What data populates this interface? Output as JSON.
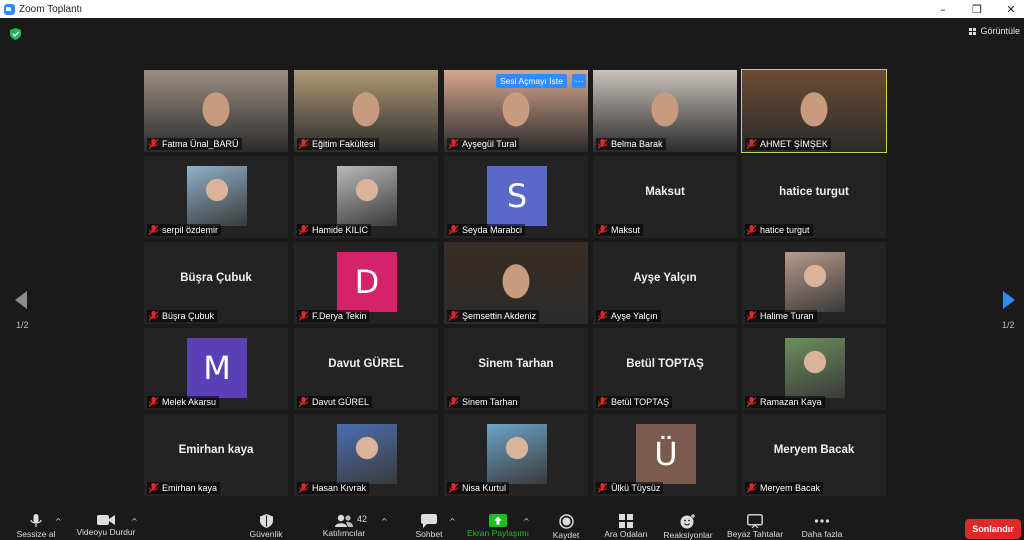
{
  "window": {
    "title": "Zoom Toplantı",
    "minimize": "–",
    "restore": "❐",
    "close": "✕"
  },
  "view_button": "Görüntüle",
  "page_indicator_left": "1/2",
  "page_indicator_right": "1/2",
  "unmute_request": "Sesi Açmayı İste",
  "more_dots": "···",
  "participants": [
    {
      "name": "Fatma Ünal_BARÜ",
      "display": "",
      "type": "video",
      "bg": "#9b8f84"
    },
    {
      "name": "Eğitim Fakültesi",
      "display": "",
      "type": "video",
      "bg": "#b09a76"
    },
    {
      "name": "Ayşegül Tural",
      "display": "",
      "type": "video",
      "bg": "#d7a690"
    },
    {
      "name": "Belma Barak",
      "display": "",
      "type": "video",
      "bg": "#c9c3bd"
    },
    {
      "name": "AHMET ŞİMŞEK",
      "display": "",
      "type": "video",
      "bg": "#6c4b33"
    },
    {
      "name": "serpil özdemir",
      "display": "",
      "type": "photo",
      "bg": "#8fb1c9"
    },
    {
      "name": "Hamide KILIC",
      "display": "",
      "type": "photo",
      "bg": "#b9b9b9"
    },
    {
      "name": "Seyda Marabci",
      "display": "S",
      "type": "letter",
      "bg": "#5a69c8"
    },
    {
      "name": "Maksut",
      "display": "Maksut",
      "type": "name"
    },
    {
      "name": "hatice turgut",
      "display": "hatice turgut",
      "type": "name"
    },
    {
      "name": "Büşra Çubuk",
      "display": "Büşra Çubuk",
      "type": "name"
    },
    {
      "name": "F.Derya Tekin",
      "display": "D",
      "type": "letter",
      "bg": "#d3246b"
    },
    {
      "name": "Şemsettin Akdeniz",
      "display": "",
      "type": "video",
      "bg": "#3a2d25"
    },
    {
      "name": "Ayşe Yalçın",
      "display": "Ayşe Yalçın",
      "type": "name"
    },
    {
      "name": "Halime Turan",
      "display": "",
      "type": "photo",
      "bg": "#b89a88"
    },
    {
      "name": "Melek Akarsu",
      "display": "M",
      "type": "letter",
      "bg": "#5b3fb6"
    },
    {
      "name": "Davut GÜREL",
      "display": "Davut GÜREL",
      "type": "name"
    },
    {
      "name": "Sinem Tarhan",
      "display": "Sinem Tarhan",
      "type": "name"
    },
    {
      "name": "Betül TOPTAŞ",
      "display": "Betül TOPTAŞ",
      "type": "name"
    },
    {
      "name": "Ramazan Kaya",
      "display": "",
      "type": "photo",
      "bg": "#6d8f5c"
    },
    {
      "name": "Emirhan kaya",
      "display": "Emirhan kaya",
      "type": "name"
    },
    {
      "name": "Hasan Kıvrak",
      "display": "",
      "type": "photo",
      "bg": "#4a6fb0"
    },
    {
      "name": "Nisa Kurtul",
      "display": "",
      "type": "photo",
      "bg": "#6aa5c9"
    },
    {
      "name": "Ülkü Tüysüz",
      "display": "Ü",
      "type": "letter",
      "bg": "#7b5a4e"
    },
    {
      "name": "Meryem Bacak",
      "display": "Meryem Bacak",
      "type": "name"
    }
  ],
  "toolbar": {
    "mute": "Sessize al",
    "video": "Videoyu Durdur",
    "security": "Güvenlik",
    "participants": "Katılımcılar",
    "participants_count": "42",
    "chat": "Sohbet",
    "share": "Ekran Paylaşımı",
    "record": "Kaydet",
    "breakout": "Ara Odaları",
    "reactions": "Reaksiyonlar",
    "whiteboards": "Beyaz Tahtalar",
    "more": "Daha fazla",
    "caret": "^",
    "end": "Sonlandır"
  },
  "colors": {
    "active_speaker": "#c7d64f",
    "share_green": "#19c11b",
    "end_red": "#e02828",
    "accent_blue": "#2d8cff",
    "mic_off_red": "#e02828"
  },
  "icons": [
    "shield-icon",
    "grid-view-icon",
    "left-arrow-icon",
    "right-arrow-icon",
    "mic-icon",
    "video-icon",
    "security-icon",
    "participants-icon",
    "chat-icon",
    "share-screen-icon",
    "record-icon",
    "breakout-icon",
    "reactions-icon",
    "whiteboard-icon",
    "more-icon",
    "mic-off-icon"
  ]
}
